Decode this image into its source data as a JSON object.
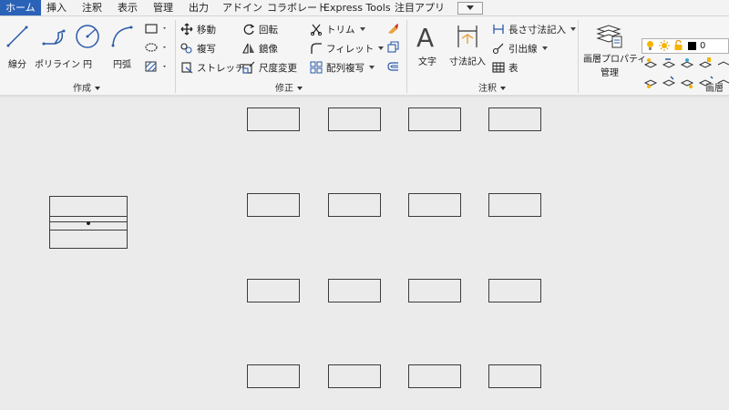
{
  "tabs": [
    "ホーム",
    "挿入",
    "注釈",
    "表示",
    "管理",
    "出力",
    "アドイン",
    "コラボレート",
    "Express Tools",
    "注目アプリ"
  ],
  "draw_group": {
    "label": "作成",
    "tools": {
      "line": "線分",
      "polyline": "ポリライン",
      "circle": "円",
      "arc": "円弧"
    }
  },
  "modify_group": {
    "label": "修正",
    "rows": [
      [
        "移動",
        "回転",
        "トリム"
      ],
      [
        "複写",
        "鏡像",
        "フィレット"
      ],
      [
        "ストレッチ",
        "尺度変更",
        "配列複写"
      ]
    ]
  },
  "annotation_group": {
    "label": "注釈",
    "text_tool": "文字",
    "dim_tool": "寸法記入",
    "linear_dim": "長さ寸法記入",
    "leader": "引出線",
    "table": "表"
  },
  "layers_group": {
    "label": "画層",
    "properties": [
      "画層プロパティ",
      "管理"
    ],
    "current_layer": "0"
  },
  "colors": {
    "accent": "#2a62b8",
    "canvas": "#ebebeb",
    "line": "#3c3c3c"
  }
}
